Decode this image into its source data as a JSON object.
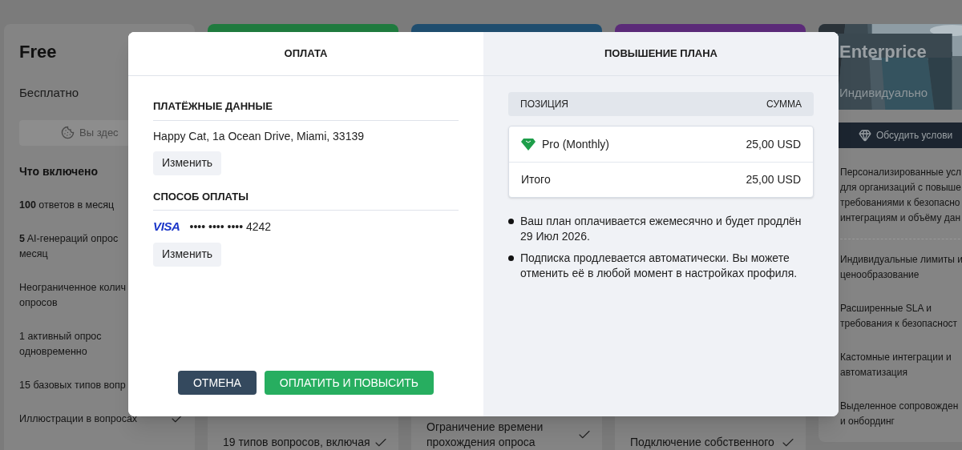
{
  "background": {
    "free_card": {
      "title": "Free",
      "price": "Бесплатно",
      "current_button": "Вы здес",
      "included_heading": "Что включено",
      "features": [
        {
          "lines": [
            "**100** ответов в месяц"
          ]
        },
        {
          "lines": [
            "**5** AI-генераций опрос",
            "месяц"
          ]
        },
        {
          "lines": [
            "Неограниченное колич",
            "опросов"
          ]
        },
        {
          "lines": [
            "1 активный опрос",
            "одновременно"
          ]
        },
        {
          "lines": [
            "15 базовых типов вопр"
          ]
        },
        {
          "lines": [
            "Иллюстрации в вопросах"
          ],
          "checked": true
        }
      ]
    },
    "middle_cards": [
      {
        "color": "#1f7a3e",
        "feature": {
          "lines": [
            "19 типов вопросов, включая"
          ],
          "checked": true
        }
      },
      {
        "color": "#1f4d6e",
        "feature": {
          "lines": [
            "Ограничение времени",
            "прохождения опроса"
          ],
          "checked": true
        }
      },
      {
        "color": "#5b2a78",
        "feature": {
          "lines": [
            "Подключение собственного"
          ],
          "checked": true
        }
      }
    ],
    "enterprise_card": {
      "title": "Enterprice",
      "price": "Индивидуально",
      "button": "Обсудить услови",
      "description": [
        "Персонализированные усл",
        "для организаций с повыше",
        "требованиями к безопасно",
        "интеграциям и объёму дан"
      ],
      "features": [
        {
          "lines": [
            "Индивидуальные лимиты и",
            "ценообразование"
          ]
        },
        {
          "lines": [
            "Расширенные SLA и",
            "требования к безопасност"
          ]
        },
        {
          "lines": [
            "Кастомные интеграции и",
            "автоматизация"
          ]
        },
        {
          "lines": [
            "Выделенное сопровожден",
            "и онбординг"
          ]
        }
      ]
    }
  },
  "modal": {
    "tabs": [
      {
        "label": "ОПЛАТА",
        "selected": true
      },
      {
        "label": "ПОВЫШЕНИЕ ПЛАНА",
        "selected": false
      }
    ],
    "billing": {
      "heading": "ПЛАТЁЖНЫЕ ДАННЫЕ",
      "address": "Happy Cat, 1a Ocean Drive, Miami, 33139",
      "button": "Изменить"
    },
    "payment_method": {
      "heading": "СПОСОБ ОПЛАТЫ",
      "brand": "VISA",
      "number": "•••• •••• •••• 4242",
      "button": "Изменить"
    },
    "buttons": [
      {
        "label": "ОТМЕНА",
        "kind": "secondary"
      },
      {
        "label": "ОПЛАТИТЬ И ПОВЫСИТЬ",
        "kind": "primary"
      }
    ],
    "summary": {
      "columns": [
        "ПОЗИЦИЯ",
        "СУММА"
      ],
      "rows": [
        {
          "kind": "item",
          "label": "Pro (Monthly)",
          "amount": "25,00 USD"
        },
        {
          "kind": "total",
          "label": "Итого",
          "amount": "25,00 USD"
        }
      ],
      "notes": [
        "Ваш план оплачивается ежемесячно и будет продлён 29 Июл 2026.",
        "Подписка продлевается автоматически. Вы можете отменить её в любой момент в настройках профиля."
      ]
    }
  }
}
